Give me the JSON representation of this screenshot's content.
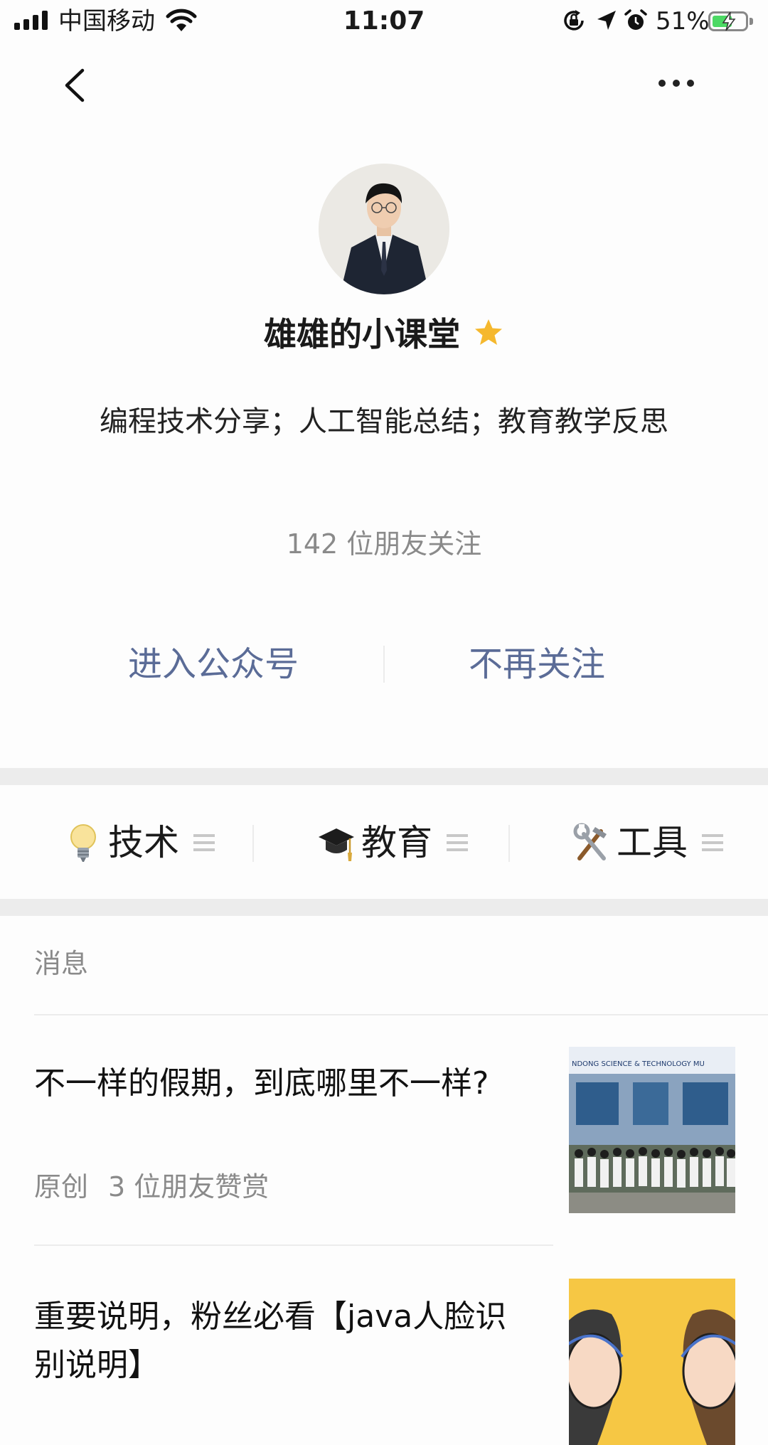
{
  "status_bar": {
    "carrier": "中国移动",
    "time": "11:07",
    "battery_percent": "51%",
    "signal_bars": 4,
    "battery_level": 0.51,
    "icons": [
      "wifi-icon",
      "orientation-lock-icon",
      "location-arrow-icon",
      "alarm-icon",
      "battery-icon"
    ]
  },
  "nav": {
    "back_icon": "chevron-left-icon",
    "more_icon": "more-dots-icon"
  },
  "profile": {
    "name": "雄雄的小课堂",
    "name_badge_icon": "star-icon",
    "description": "编程技术分享；人工智能总结；教育教学反思",
    "followers": "142 位朋友关注"
  },
  "actions": {
    "enter": "进入公众号",
    "unfollow": "不再关注",
    "color": "#5b6c97"
  },
  "menu": [
    {
      "label": "技术",
      "icon": "light-bulb-icon"
    },
    {
      "label": "教育",
      "icon": "graduation-cap-icon"
    },
    {
      "label": "工具",
      "icon": "tools-icon"
    }
  ],
  "messages": {
    "section_label": "消息",
    "articles": [
      {
        "title": "不一样的假期，到底哪里不一样?",
        "tag": "原创",
        "stats": "3 位朋友赞赏",
        "thumb_caption": "NDONG SCIENCE & TECHNOLOGY MU"
      },
      {
        "title": "重要说明，粉丝必看【java人脸识别说明】"
      }
    ]
  }
}
